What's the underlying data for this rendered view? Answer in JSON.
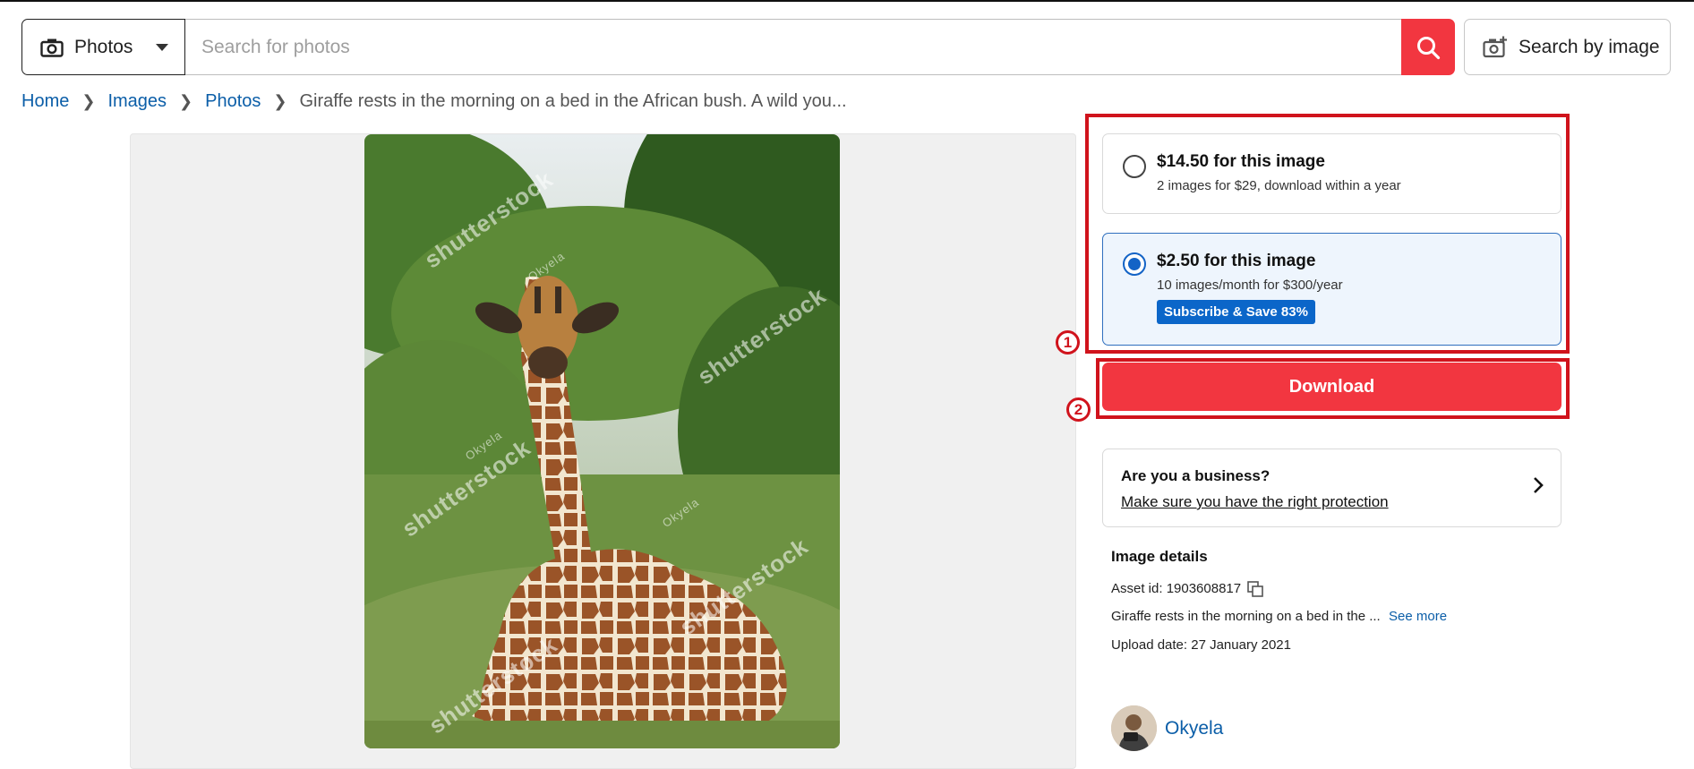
{
  "search": {
    "type_label": "Photos",
    "placeholder": "Search for photos",
    "search_by_image_label": "Search by image"
  },
  "breadcrumb": {
    "items": [
      "Home",
      "Images",
      "Photos"
    ],
    "current": "Giraffe rests in the morning on a bed in the African bush. A wild you..."
  },
  "preview": {
    "watermark_text": "shutterstock",
    "contributor_mark": "Okyela"
  },
  "pricing": {
    "options": [
      {
        "title": "$14.50 for this image",
        "subtitle": "2 images for $29, download within a year",
        "selected": false
      },
      {
        "title": "$2.50 for this image",
        "subtitle": "10 images/month for $300/year",
        "badge": "Subscribe & Save 83%",
        "selected": true
      }
    ],
    "download_label": "Download",
    "annotations": [
      "1",
      "2"
    ]
  },
  "business": {
    "title": "Are you a business?",
    "link": "Make sure you have the right protection"
  },
  "details": {
    "title": "Image details",
    "asset_id": "Asset id: 1903608817",
    "description": "Giraffe rests in the morning on a bed in the ...",
    "see_more": "See more",
    "upload_date": "Upload date: 27 January 2021"
  },
  "contributor": {
    "name": "Okyela"
  },
  "colors": {
    "accent_red": "#f23640",
    "link_blue": "#0b5ea8",
    "selected_blue": "#1363c6",
    "annotation_red": "#d0131c"
  }
}
